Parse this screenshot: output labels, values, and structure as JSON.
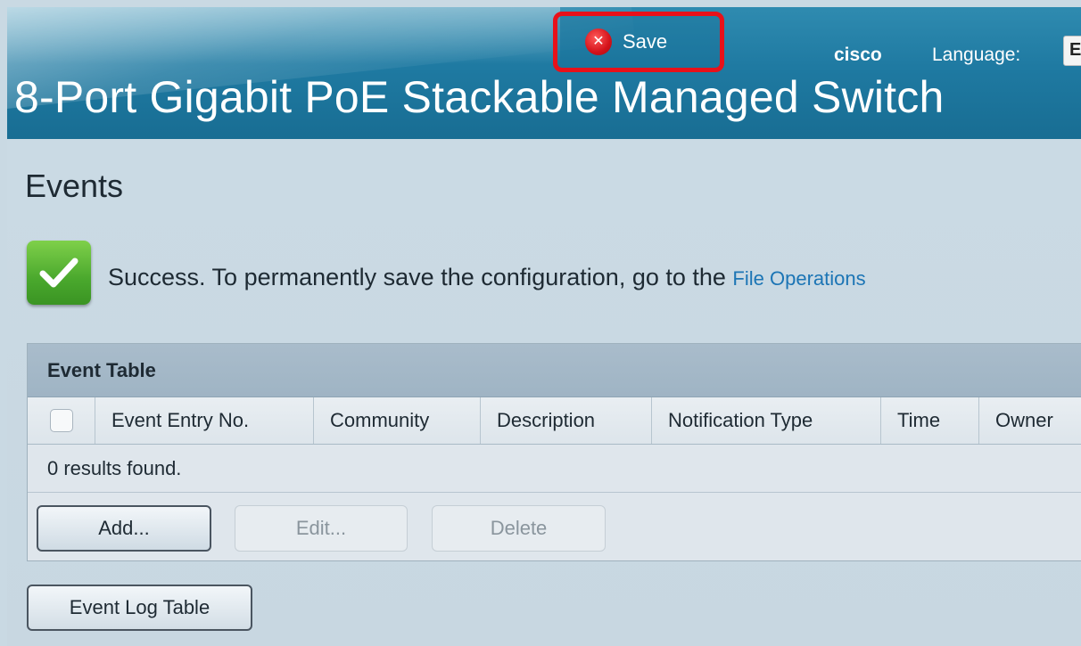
{
  "header": {
    "save_label": "Save",
    "user": "cisco",
    "language_label": "Language:",
    "language_value": "E",
    "product_title": "8-Port Gigabit PoE Stackable Managed Switch"
  },
  "page": {
    "title": "Events"
  },
  "success": {
    "message": "Success. To permanently save the configuration, go to the ",
    "link_text": "File Operations"
  },
  "event_table": {
    "caption": "Event Table",
    "columns": [
      "Event Entry No.",
      "Community",
      "Description",
      "Notification Type",
      "Time",
      "Owner"
    ],
    "results_text": "0 results found.",
    "buttons": {
      "add": "Add...",
      "edit": "Edit...",
      "delete": "Delete"
    }
  },
  "event_log_button": "Event Log Table",
  "colors": {
    "header_blue": "#1f7aa2",
    "highlight_red": "#e8111a",
    "success_green": "#4aa82d",
    "link_blue": "#1c75b5"
  },
  "icons": {
    "save": "x-circle-icon",
    "success": "checkmark-icon"
  }
}
